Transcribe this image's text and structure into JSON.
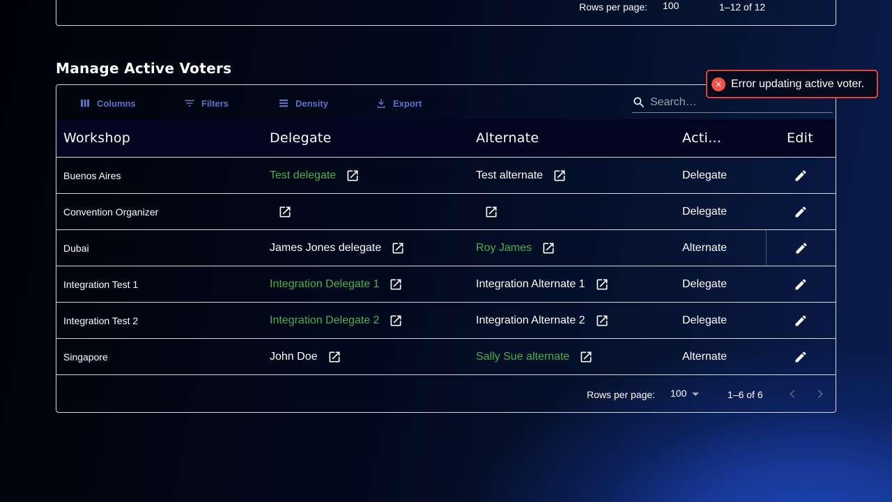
{
  "top_table": {
    "rows_per_page_label": "Rows per page:",
    "rows_per_page_value": "100",
    "range": "1–12 of 12"
  },
  "section": {
    "title": "Manage Active Voters"
  },
  "toolbar": {
    "columns": "Columns",
    "filters": "Filters",
    "density": "Density",
    "export": "Export",
    "search_placeholder": "Search…"
  },
  "headers": {
    "workshop": "Workshop",
    "delegate": "Delegate",
    "alternate": "Alternate",
    "active": "Acti…",
    "edit": "Edit"
  },
  "rows": [
    {
      "workshop": "Buenos Aires",
      "delegate": "Test delegate",
      "delegate_active": true,
      "alternate": "Test alternate",
      "alternate_active": false,
      "active": "Delegate"
    },
    {
      "workshop": "Convention Organizer",
      "delegate": "",
      "delegate_active": false,
      "alternate": "",
      "alternate_active": false,
      "active": "Delegate"
    },
    {
      "workshop": "Dubai",
      "delegate": "James Jones delegate",
      "delegate_active": false,
      "alternate": "Roy James",
      "alternate_active": true,
      "active": "Alternate"
    },
    {
      "workshop": "Integration Test 1",
      "delegate": "Integration Delegate 1",
      "delegate_active": true,
      "alternate": "Integration Alternate 1",
      "alternate_active": false,
      "active": "Delegate"
    },
    {
      "workshop": "Integration Test 2",
      "delegate": "Integration Delegate 2",
      "delegate_active": true,
      "alternate": "Integration Alternate 2",
      "alternate_active": false,
      "active": "Delegate"
    },
    {
      "workshop": "Singapore",
      "delegate": "John Doe",
      "delegate_active": false,
      "alternate": "Sally Sue alternate",
      "alternate_active": true,
      "active": "Alternate"
    }
  ],
  "footer": {
    "rows_per_page_label": "Rows per page:",
    "rows_per_page_value": "100",
    "range": "1–6 of 6"
  },
  "toast": {
    "message": "Error updating active voter."
  },
  "colors": {
    "active_name": "#4caf50",
    "accent": "#5b73c9",
    "error": "#f0524a"
  }
}
